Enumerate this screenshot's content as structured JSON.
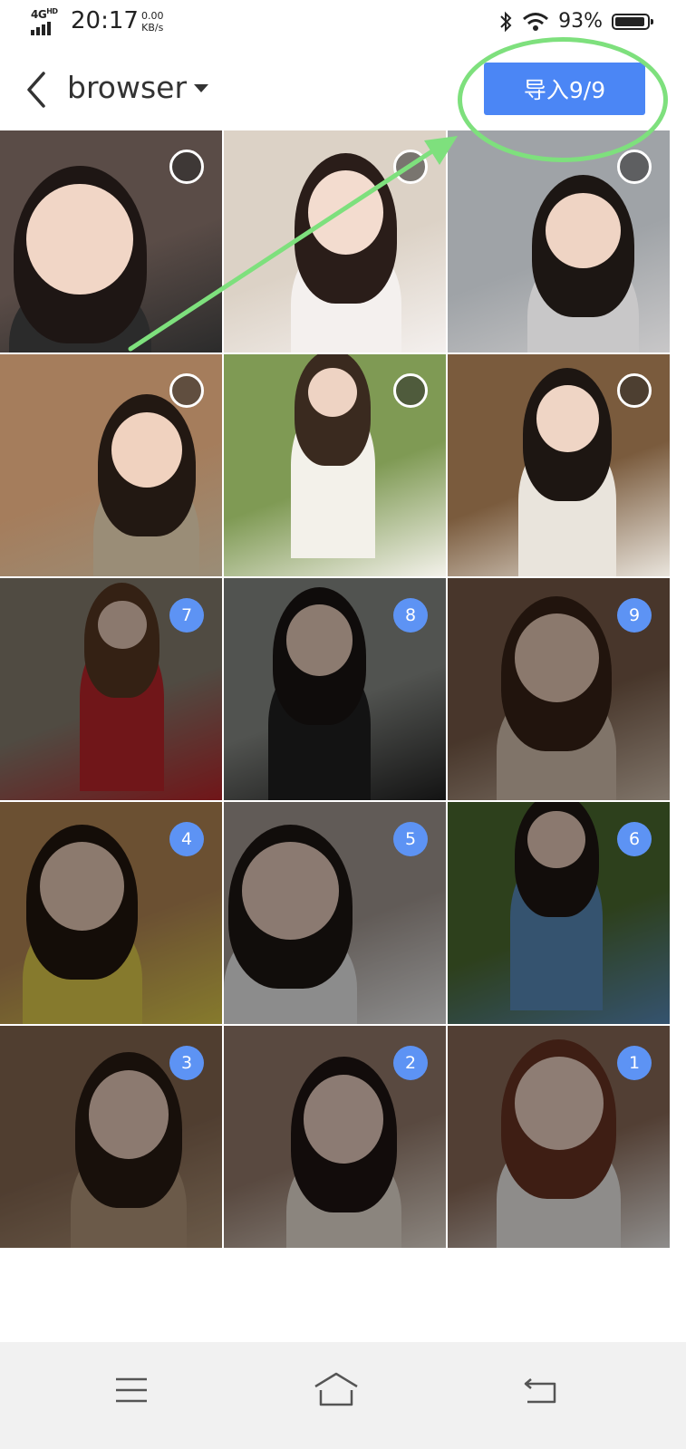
{
  "status_bar": {
    "network": "4G",
    "network_sup": "HD",
    "time": "20:17",
    "speed_value": "0.00",
    "speed_unit": "KB/s",
    "battery_percent": "93%",
    "battery_level": 0.93
  },
  "header": {
    "back_icon": "chevron-left-icon",
    "album_name": "browser",
    "import_button": "导入9/9",
    "accent_color": "#4b86f5"
  },
  "grid": {
    "cells": [
      {
        "selection_order": ""
      },
      {
        "selection_order": ""
      },
      {
        "selection_order": ""
      },
      {
        "selection_order": ""
      },
      {
        "selection_order": ""
      },
      {
        "selection_order": ""
      },
      {
        "selection_order": "7"
      },
      {
        "selection_order": "8"
      },
      {
        "selection_order": "9"
      },
      {
        "selection_order": "4"
      },
      {
        "selection_order": "5"
      },
      {
        "selection_order": "6"
      },
      {
        "selection_order": "3"
      },
      {
        "selection_order": "2"
      },
      {
        "selection_order": "1"
      }
    ]
  },
  "navbar": {
    "menu_icon": "menu-icon",
    "home_icon": "home-icon",
    "back_icon": "back-icon"
  },
  "annotation_color": "#7ee07d"
}
